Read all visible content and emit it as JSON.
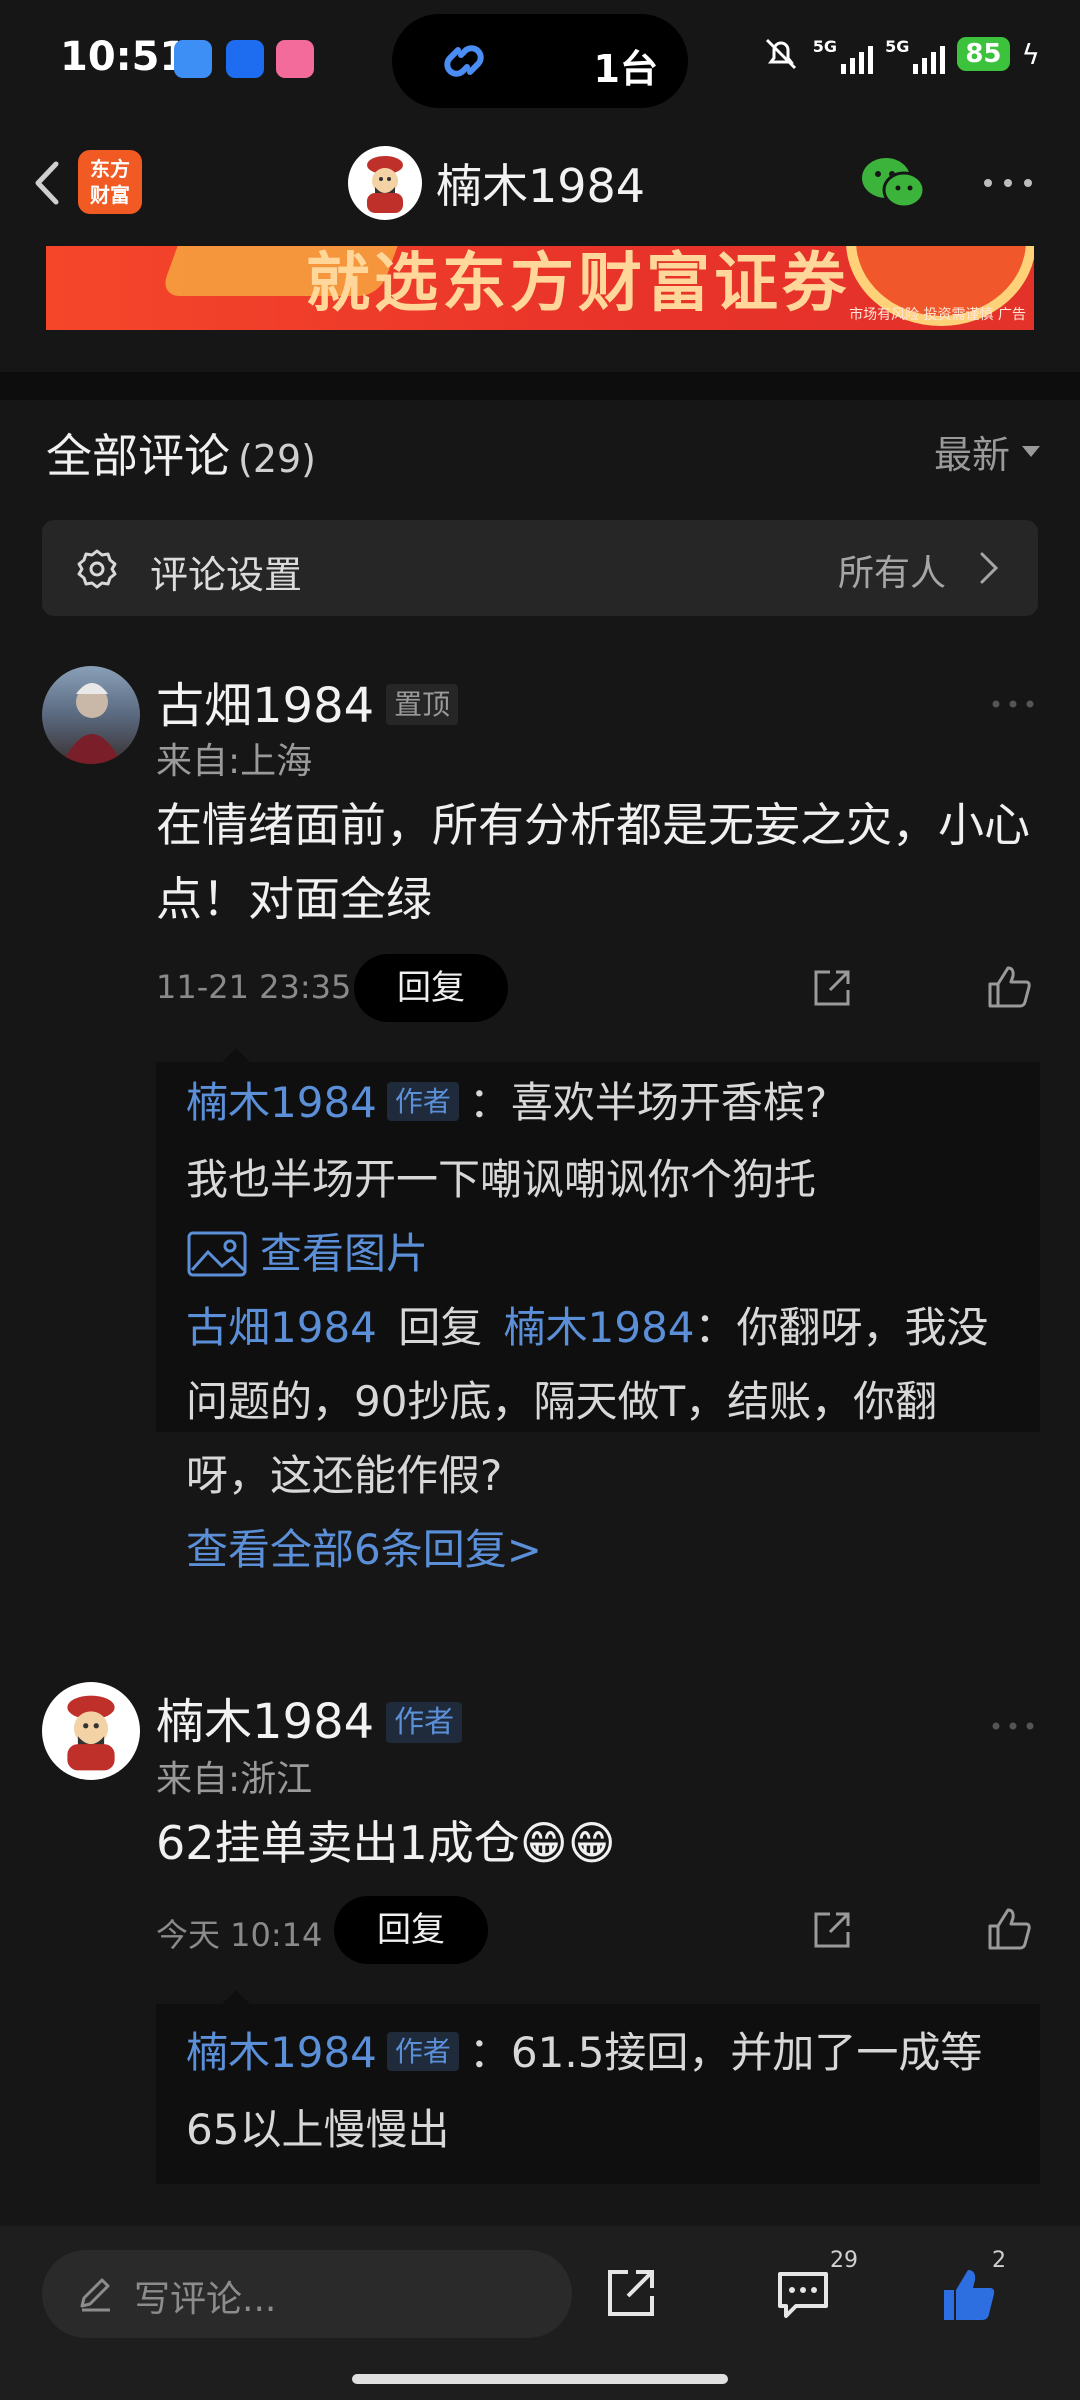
{
  "status": {
    "time": "10:51",
    "pill_text": "1台",
    "sig1": "5G",
    "sig2": "5G",
    "battery": "85"
  },
  "nav": {
    "logo_line1": "东方",
    "logo_line2": "财富",
    "title": "楠木1984"
  },
  "banner": {
    "text": "就选东方财富证券",
    "note": "市场有风险 投资需谨慎 广告"
  },
  "comments_header": {
    "title": "全部评论",
    "count": "(29)",
    "sort": "最新"
  },
  "settings": {
    "label": "评论设置",
    "value": "所有人"
  },
  "comments": [
    {
      "username": "古畑1984",
      "badge": "置顶",
      "location": "来自:上海",
      "text_line1": "在情绪面前，所有分析都是无妄之灾，小心",
      "text_line2": "点！对面全绿",
      "time": "11-21 23:35",
      "reply_label": "回复",
      "replies": {
        "r1_name": "楠木1984",
        "r1_badge": "作者",
        "r1_text1": "：喜欢半场开香槟?",
        "r1_text2": "我也半场开一下嘲讽嘲讽你个狗托",
        "view_pic": "查看图片",
        "r2_name": "古畑1984",
        "r2_mid": "回复",
        "r2_target": "楠木1984",
        "r2_text1": "：你翻呀，我没",
        "r2_text2": "问题的，90抄底，隔天做T，结账，你翻",
        "r2_text3": "呀，这还能作假?",
        "view_all": "查看全部6条回复>"
      }
    },
    {
      "username": "楠木1984",
      "badge": "作者",
      "location": "来自:浙江",
      "text_line1": "62挂单卖出1成仓😁😁",
      "time": "今天 10:14",
      "reply_label": "回复",
      "replies": {
        "r1_name": "楠木1984",
        "r1_badge": "作者",
        "r1_text1": "：61.5接回，并加了一成等",
        "r1_text2": "65以上慢慢出"
      }
    }
  ],
  "bottom": {
    "placeholder": "写评论...",
    "comment_count": "29",
    "like_count": "2"
  },
  "colors": {
    "background": "#161616",
    "link_blue": "#5b8fd8",
    "brand_orange": "#f15a22",
    "like_blue": "#2d6fe0"
  }
}
